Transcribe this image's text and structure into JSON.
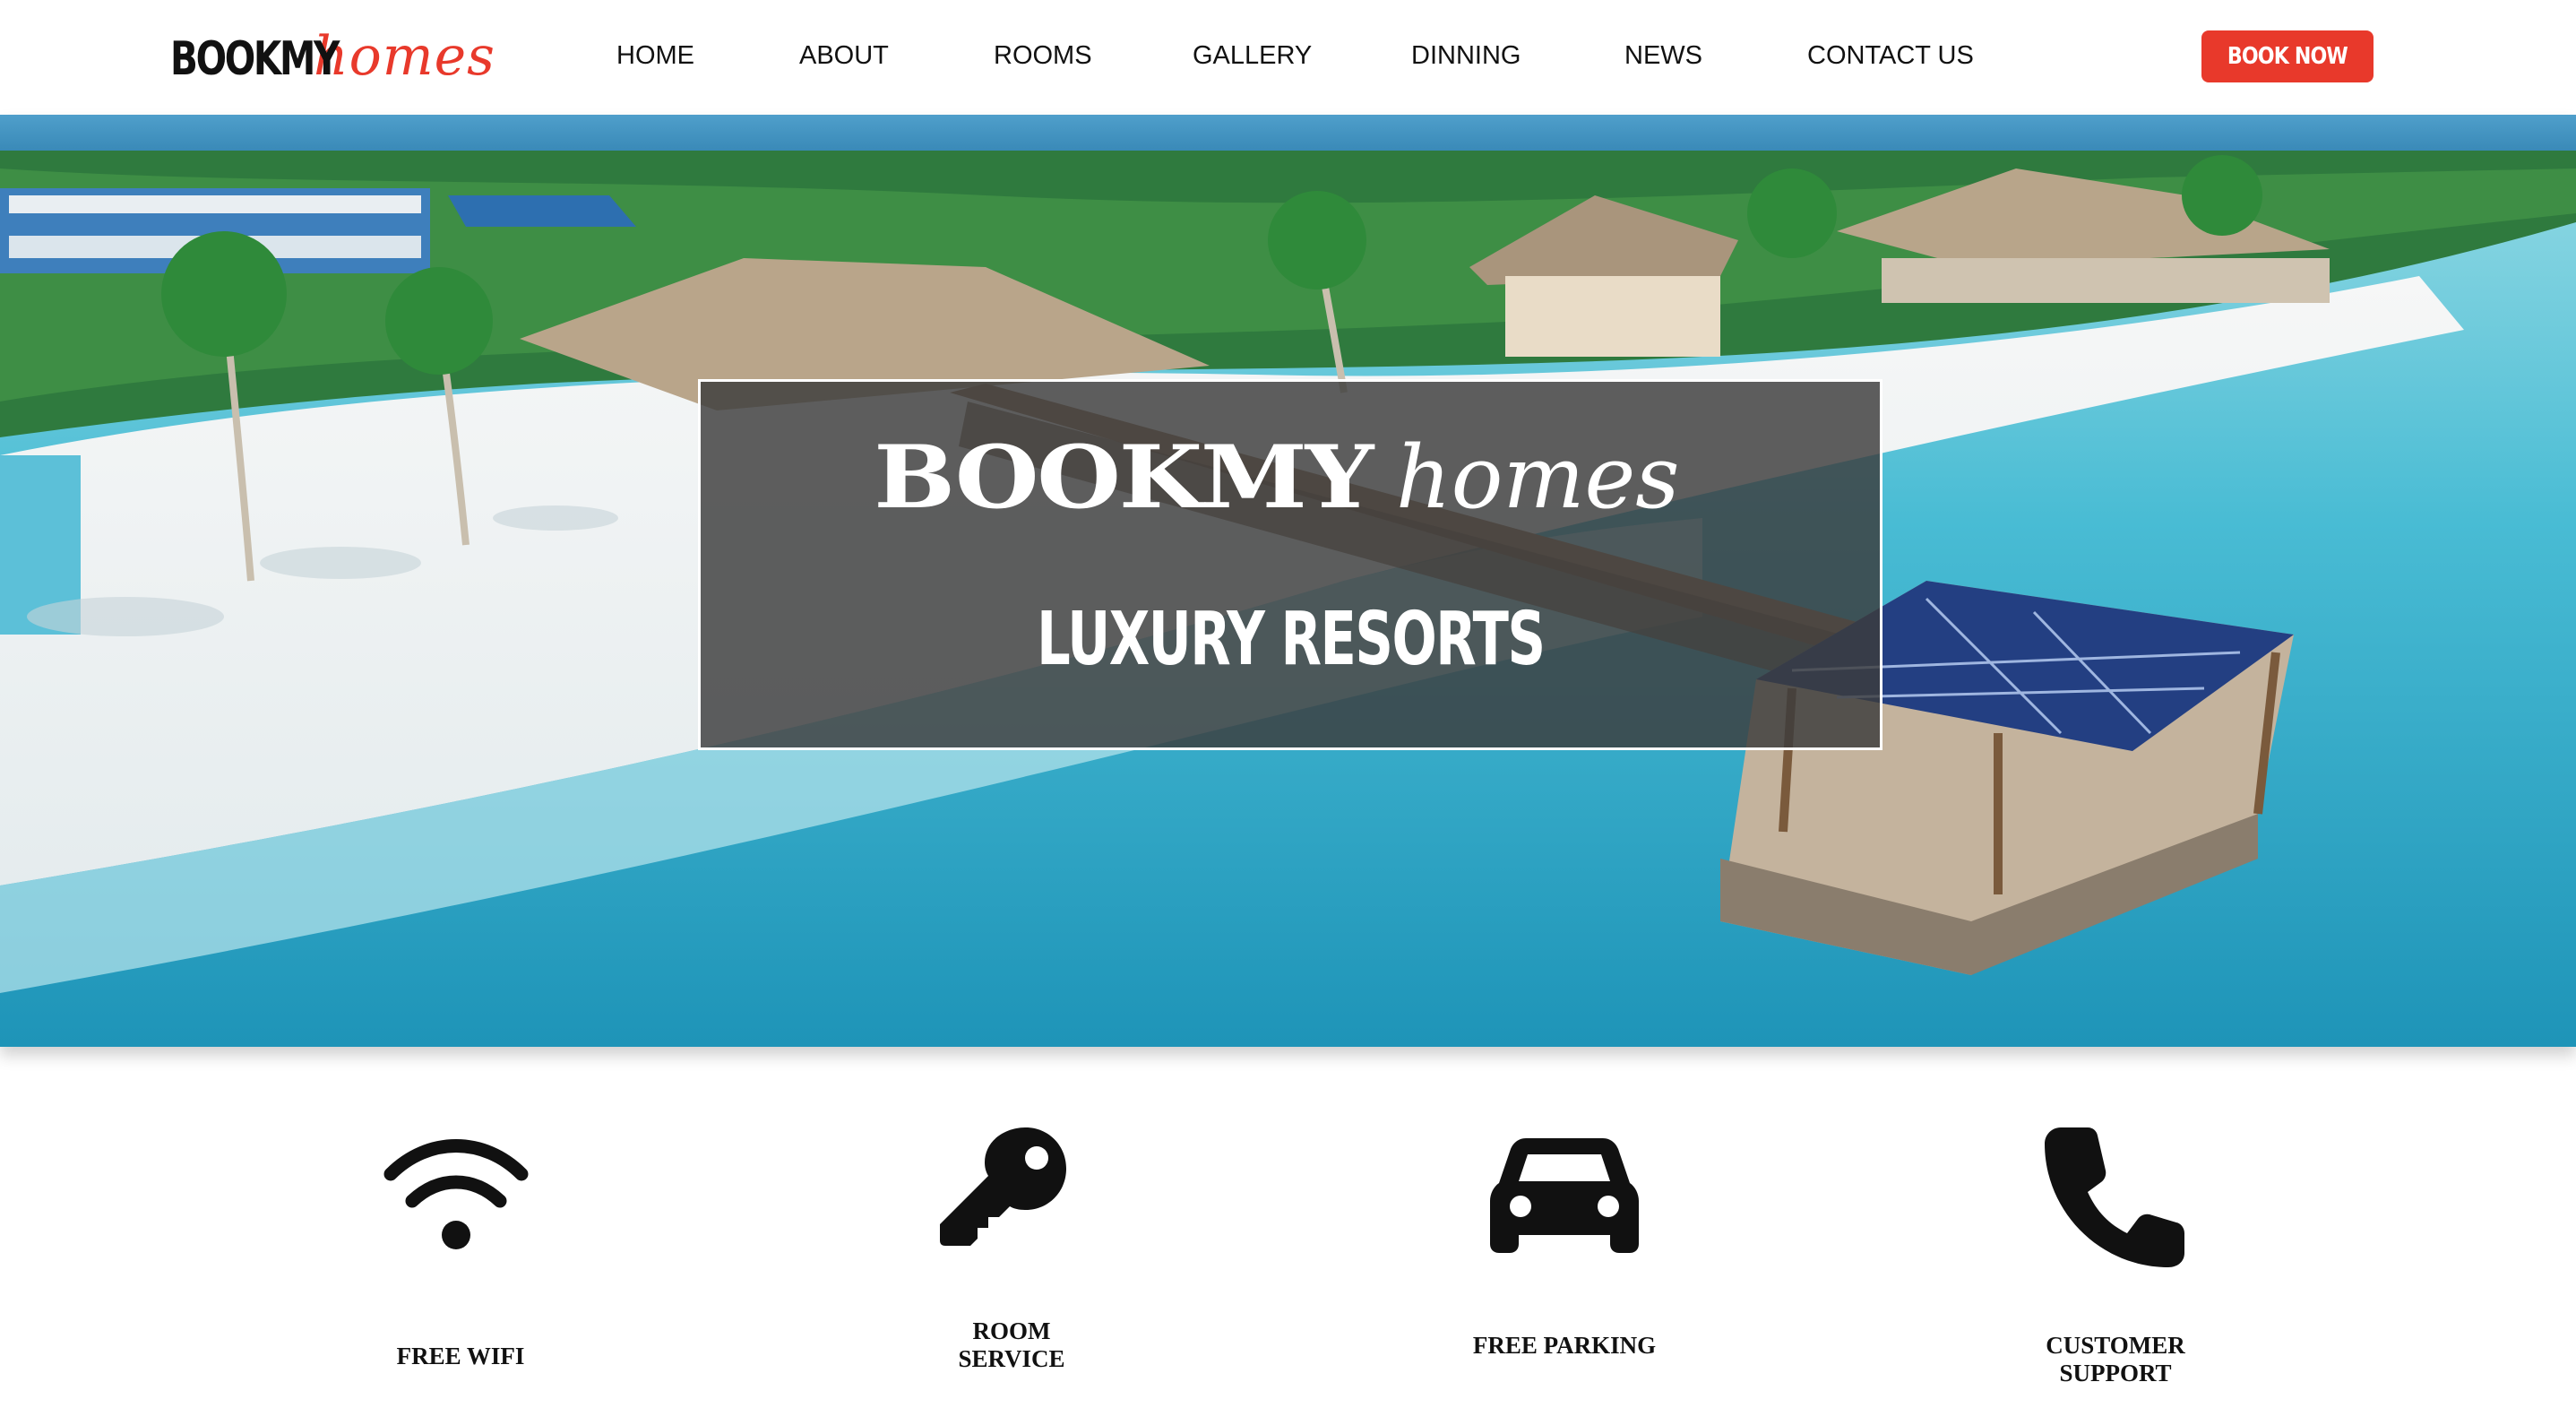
{
  "header": {
    "logo": {
      "bold": "BOOKMY",
      "script": "homes",
      "script_color": "#e8392b"
    },
    "nav": [
      {
        "label": "HOME"
      },
      {
        "label": "ABOUT"
      },
      {
        "label": "ROOMS"
      },
      {
        "label": "GALLERY"
      },
      {
        "label": "DINNING"
      },
      {
        "label": "NEWS"
      },
      {
        "label": "CONTACT US"
      }
    ],
    "book_button": {
      "label": "BOOK NOW",
      "color": "#e8392b"
    }
  },
  "hero": {
    "brand_bold": "BOOKMY",
    "brand_script": "homes",
    "tagline": "LUXURY RESORTS",
    "background": "aerial-resort-beach-photo"
  },
  "features": [
    {
      "label": "FREE WIFI",
      "icon": "wifi-icon"
    },
    {
      "label": "ROOM\nSERVICE",
      "icon": "key-icon"
    },
    {
      "label": "FREE PARKING",
      "icon": "car-icon"
    },
    {
      "label": "CUSTOMER\nSUPPORT",
      "icon": "phone-icon"
    }
  ]
}
